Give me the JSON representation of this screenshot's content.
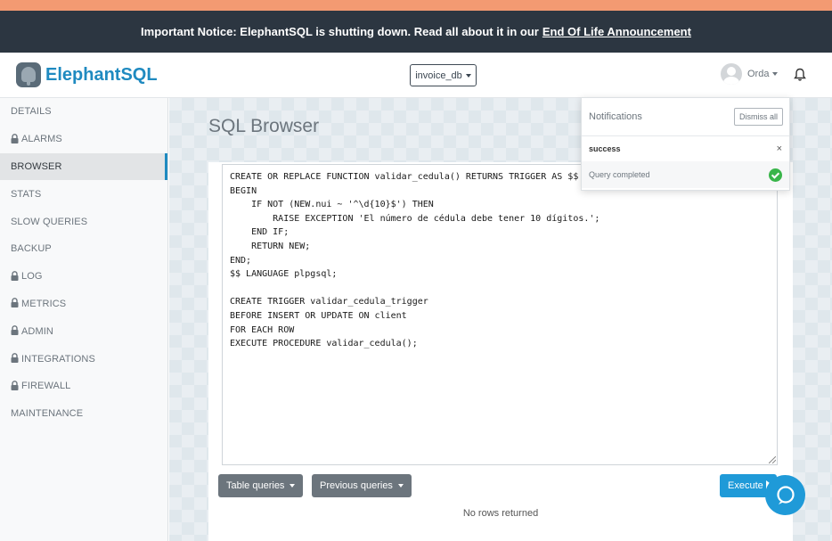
{
  "notice": {
    "text": "Important Notice: ElephantSQL is shutting down. Read all about it in our",
    "link": "End Of Life Announcement"
  },
  "header": {
    "brand": "ElephantSQL",
    "database": "invoice_db",
    "user": "Orda"
  },
  "sidebar": {
    "items": [
      {
        "label": "DETAILS",
        "locked": false
      },
      {
        "label": "ALARMS",
        "locked": true
      },
      {
        "label": "BROWSER",
        "locked": false,
        "active": true
      },
      {
        "label": "STATS",
        "locked": false
      },
      {
        "label": "SLOW QUERIES",
        "locked": false
      },
      {
        "label": "BACKUP",
        "locked": false
      },
      {
        "label": "LOG",
        "locked": true
      },
      {
        "label": "METRICS",
        "locked": true
      },
      {
        "label": "ADMIN",
        "locked": true
      },
      {
        "label": "INTEGRATIONS",
        "locked": true
      },
      {
        "label": "FIREWALL",
        "locked": true
      },
      {
        "label": "MAINTENANCE",
        "locked": false
      }
    ]
  },
  "main": {
    "title": "SQL Browser",
    "query": "CREATE OR REPLACE FUNCTION validar_cedula() RETURNS TRIGGER AS $$\nBEGIN\n    IF NOT (NEW.nui ~ '^\\d{10}$') THEN\n        RAISE EXCEPTION 'El número de cédula debe tener 10 dígitos.';\n    END IF;\n    RETURN NEW;\nEND;\n$$ LANGUAGE plpgsql;\n\nCREATE TRIGGER validar_cedula_trigger\nBEFORE INSERT OR UPDATE ON client\nFOR EACH ROW\nEXECUTE PROCEDURE validar_cedula();",
    "table_queries_label": "Table queries",
    "previous_queries_label": "Previous queries",
    "execute_label": "Execute",
    "result_text": "No rows returned"
  },
  "notifications": {
    "title": "Notifications",
    "dismiss_label": "Dismiss all",
    "category": "success",
    "close_glyph": "×",
    "message": "Query completed"
  },
  "colors": {
    "brand": "#1f8ac0",
    "notice_bg": "#2c3641",
    "top_strip": "#f39a72",
    "execute": "#1f9ad8",
    "success": "#39b54a"
  },
  "icons": [
    "elephant-logo-icon",
    "bell-icon",
    "lock-icon",
    "play-icon",
    "check-icon",
    "chat-icon"
  ]
}
